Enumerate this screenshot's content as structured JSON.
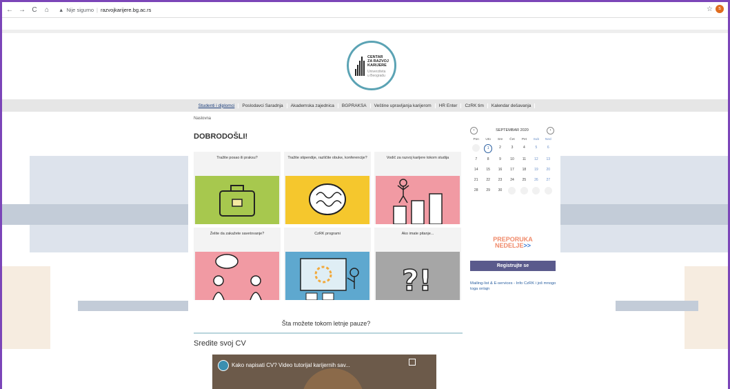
{
  "browser": {
    "security_label": "Nije sigurno",
    "host": "razvojkarijere.bg.ac.rs",
    "profile_initial": "s"
  },
  "logo": {
    "line1": "CENTAR",
    "line2": "ZA RAZVOJ",
    "line3": "KARIJERE",
    "line4": "Univerziteta",
    "line5": "u Beogradu"
  },
  "nav": {
    "items": [
      "Studenti i diplomci",
      "Poslodavci Saradnja",
      "Akademska zajednica",
      "BGPRAKSA",
      "Veštine upravljanja karijerom",
      "HR Enter",
      "CzRK tim",
      "Kalendar dešavanja"
    ]
  },
  "breadcrumb": "Naslovna",
  "welcome": "DOBRODOŠLI!",
  "cards": [
    {
      "caption": "Tražite posao ili praksu?",
      "color": "#a7c84e",
      "icon": "briefcase-icon"
    },
    {
      "caption": "Tražite stipendije, različite obuke, konferencije?",
      "color": "#f5c72d",
      "icon": "brain-icon"
    },
    {
      "caption": "Vodič za razvoj karijere tokom studija",
      "color": "#f19aa3",
      "icon": "career-steps-icon"
    },
    {
      "caption": "Želite da zakažete savetovanje?",
      "color": "#f19aa3",
      "icon": "counseling-icon"
    },
    {
      "caption": "CzRK programi",
      "color": "#5ea8cf",
      "icon": "gear-icon"
    },
    {
      "caption": "Ako imate pitanje...",
      "color": "#a6a6a6",
      "icon": "question-icon"
    }
  ],
  "summer": "Šta možete tokom letnje pauze?",
  "cv_title": "Sredite svoj CV",
  "video": {
    "title": "Kako napisati CV? Video tutorijal karijernih sav..."
  },
  "calendar": {
    "month": "SEPTEMBAR 2020",
    "dow": [
      "Pon",
      "Uto",
      "Sre",
      "Čet",
      "Pet",
      "Sub",
      "Ned"
    ],
    "days": [
      [
        "",
        "1",
        "2",
        "3",
        "4",
        "5",
        "6"
      ],
      [
        "7",
        "8",
        "9",
        "10",
        "11",
        "12",
        "13"
      ],
      [
        "14",
        "15",
        "16",
        "17",
        "18",
        "19",
        "20"
      ],
      [
        "21",
        "22",
        "23",
        "24",
        "25",
        "26",
        "27"
      ],
      [
        "28",
        "29",
        "30",
        "",
        "",
        "",
        ""
      ]
    ],
    "today": "1"
  },
  "promo": {
    "line1": "PREPORUKA",
    "line2": "NEDELJE",
    "arrows": ">>"
  },
  "register_label": "Registrujte se",
  "mailing_text": "Mailing-list & E-services - Info CzRK i još mnogo toga onlajn"
}
